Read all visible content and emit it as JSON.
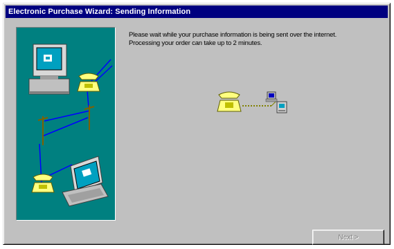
{
  "window": {
    "title": "Electronic Purchase Wizard: Sending Information"
  },
  "message": {
    "line1": "Please wait while your purchase information is being sent over the internet.",
    "line2": "Processing your order can take up to 2 minutes."
  },
  "buttons": {
    "next_label": "Next >",
    "next_enabled": false
  },
  "icons": {
    "art_panel": [
      "desktop-computer-icon",
      "telephone-icon",
      "utility-pole-icon",
      "laptop-icon"
    ],
    "connection": [
      "telephone-icon",
      "network-computer-icon"
    ]
  },
  "colors": {
    "titlebar": "#000080",
    "dialog_face": "#c0c0c0",
    "art_background": "#008080",
    "phone_line": "#0000ff",
    "phone": "#ffff80"
  }
}
